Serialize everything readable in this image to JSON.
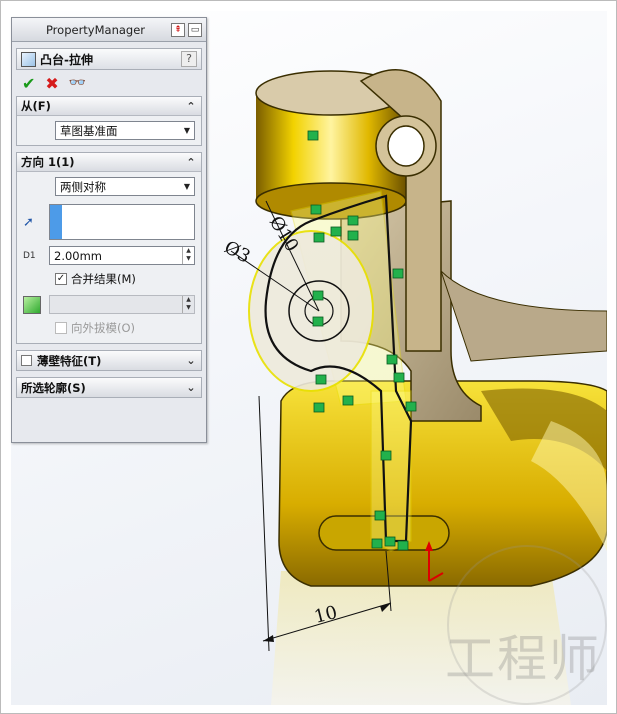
{
  "panel": {
    "title": "PropertyManager",
    "feature_name": "凸台-拉伸",
    "help_label": "?",
    "actions": {
      "ok": "✔",
      "cancel": "✖",
      "preview": "👓"
    }
  },
  "groups": {
    "from": {
      "title": "从(F)",
      "selected_value": "草图基准面"
    },
    "direction1": {
      "title": "方向 1(1)",
      "end_condition": "两侧对称",
      "depth_value": "2.00mm",
      "depth_icon_label": "D1",
      "merge_result_label": "合并结果(M)",
      "merge_result_checked": true,
      "draft_outward_label": "向外拔模(O)",
      "draft_outward_checked": false
    },
    "thin_feature": {
      "title": "薄壁特征(T)"
    },
    "selected_contours": {
      "title": "所选轮廓(S)"
    }
  },
  "dimensions": {
    "diameter_10": "Ø10",
    "diameter_3": "Ø3",
    "horizontal_10": "10"
  },
  "watermark": "工程师",
  "colors": {
    "part_gold": "#e6c300",
    "panel_bg": "#e7e9ee",
    "sketch_green": "#22b14c",
    "accent_blue": "#4d9be8"
  }
}
